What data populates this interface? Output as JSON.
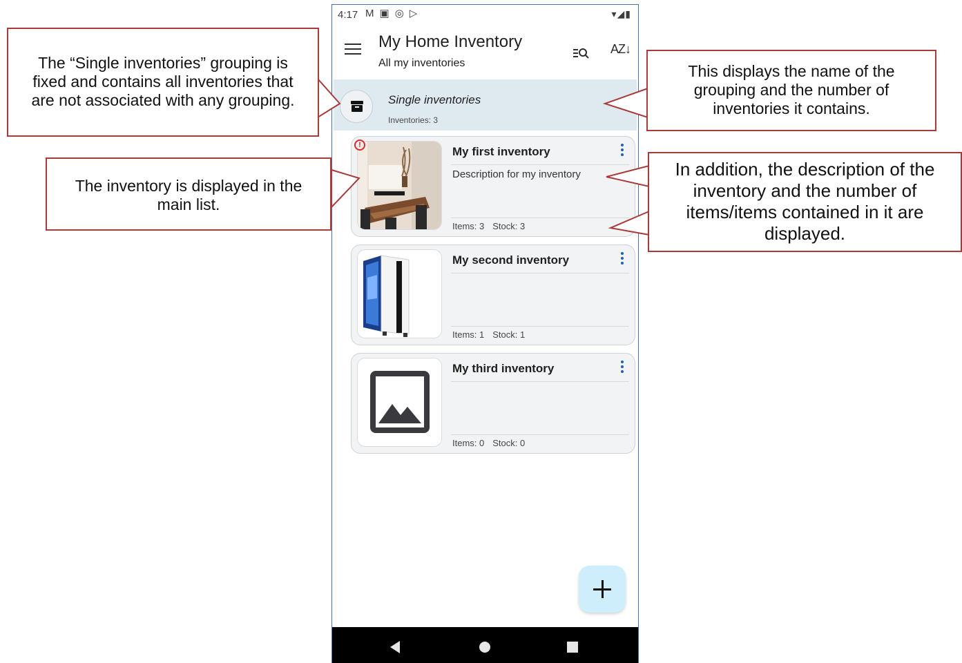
{
  "statusbar": {
    "time": "4:17",
    "notif_icons": [
      "gmail-icon",
      "app-icon",
      "at-icon",
      "play-icon"
    ],
    "right_icons": "▾◢▮"
  },
  "appbar": {
    "title": "My Home Inventory",
    "subtitle": "All my inventories"
  },
  "group": {
    "name": "Single inventories",
    "count": "Inventories: 3"
  },
  "inventories": [
    {
      "title": "My first inventory",
      "description": "Description for my inventory",
      "items": "Items: 3",
      "stock": "Stock: 3"
    },
    {
      "title": "My second inventory",
      "description": "",
      "items": "Items: 1",
      "stock": "Stock: 1"
    },
    {
      "title": "My third inventory",
      "description": "",
      "items": "Items: 0",
      "stock": "Stock: 0"
    }
  ],
  "callouts": {
    "grouping_fixed": "The “Single inventories” grouping is fixed and contains all inventories that are not associated with any grouping.",
    "grouping_name": "This displays the name of the grouping and the number of inventories it contains.",
    "main_list": "The inventory is displayed in the main list.",
    "description_items": "In addition, the description of the inventory and the number of items/items contained in it are displayed."
  },
  "colors": {
    "callout_border": "#a83a3a",
    "group_bg": "#dfe9f0",
    "fab_bg": "#cfeefb",
    "accent": "#1d5fb8"
  }
}
